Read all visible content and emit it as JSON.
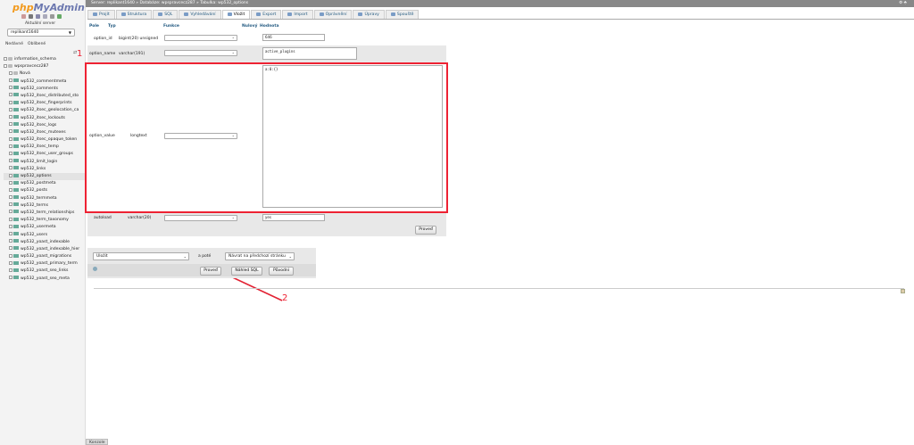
{
  "logo": {
    "part1": "php",
    "part2": "MyAdmin"
  },
  "left": {
    "server_label": "Aktuální server",
    "server_value": "replikant1640",
    "recent": "Nedávné",
    "favorites": "Oblíbené",
    "collapse": "⇄"
  },
  "tree": [
    {
      "label": "information_schema",
      "level": 1,
      "kind": "db"
    },
    {
      "label": "wpspravcecz287",
      "level": 1,
      "kind": "db"
    },
    {
      "label": "Nová",
      "level": 2,
      "kind": "new"
    },
    {
      "label": "wp532_commentmeta",
      "level": 2,
      "kind": "tbl"
    },
    {
      "label": "wp532_comments",
      "level": 2,
      "kind": "tbl"
    },
    {
      "label": "wp532_itsec_distributed_sto",
      "level": 2,
      "kind": "tbl"
    },
    {
      "label": "wp532_itsec_fingerprints",
      "level": 2,
      "kind": "tbl"
    },
    {
      "label": "wp532_itsec_geolocation_ca",
      "level": 2,
      "kind": "tbl"
    },
    {
      "label": "wp532_itsec_lockouts",
      "level": 2,
      "kind": "tbl"
    },
    {
      "label": "wp532_itsec_logs",
      "level": 2,
      "kind": "tbl"
    },
    {
      "label": "wp532_itsec_mutexes",
      "level": 2,
      "kind": "tbl"
    },
    {
      "label": "wp532_itsec_opaque_token",
      "level": 2,
      "kind": "tbl"
    },
    {
      "label": "wp532_itsec_temp",
      "level": 2,
      "kind": "tbl"
    },
    {
      "label": "wp532_itsec_user_groups",
      "level": 2,
      "kind": "tbl"
    },
    {
      "label": "wp532_limit_login",
      "level": 2,
      "kind": "tbl"
    },
    {
      "label": "wp532_links",
      "level": 2,
      "kind": "tbl"
    },
    {
      "label": "wp532_options",
      "level": 2,
      "kind": "tbl",
      "selected": true
    },
    {
      "label": "wp532_postmeta",
      "level": 2,
      "kind": "tbl"
    },
    {
      "label": "wp532_posts",
      "level": 2,
      "kind": "tbl"
    },
    {
      "label": "wp532_termmeta",
      "level": 2,
      "kind": "tbl"
    },
    {
      "label": "wp532_terms",
      "level": 2,
      "kind": "tbl"
    },
    {
      "label": "wp532_term_relationships",
      "level": 2,
      "kind": "tbl"
    },
    {
      "label": "wp532_term_taxonomy",
      "level": 2,
      "kind": "tbl"
    },
    {
      "label": "wp532_usermeta",
      "level": 2,
      "kind": "tbl"
    },
    {
      "label": "wp532_users",
      "level": 2,
      "kind": "tbl"
    },
    {
      "label": "wp532_yoast_indexable",
      "level": 2,
      "kind": "tbl"
    },
    {
      "label": "wp532_yoast_indexable_hier",
      "level": 2,
      "kind": "tbl"
    },
    {
      "label": "wp532_yoast_migrations",
      "level": 2,
      "kind": "tbl"
    },
    {
      "label": "wp532_yoast_primary_term",
      "level": 2,
      "kind": "tbl"
    },
    {
      "label": "wp532_yoast_seo_links",
      "level": 2,
      "kind": "tbl"
    },
    {
      "label": "wp532_yoast_seo_meta",
      "level": 2,
      "kind": "tbl"
    }
  ],
  "breadcrumb": {
    "text": "Server: replikant1640 » Databáze: wpspravcecz287 » Tabulka: wp532_options",
    "right": "⚙ ⬘"
  },
  "tabs": [
    {
      "label": "Projít",
      "active": false
    },
    {
      "label": "Struktura",
      "active": false
    },
    {
      "label": "SQL",
      "active": false
    },
    {
      "label": "Vyhledávání",
      "active": false
    },
    {
      "label": "Vložit",
      "active": true
    },
    {
      "label": "Export",
      "active": false
    },
    {
      "label": "Import",
      "active": false
    },
    {
      "label": "Oprávnění",
      "active": false
    },
    {
      "label": "Úpravy",
      "active": false
    },
    {
      "label": "Spouště",
      "active": false
    }
  ],
  "form": {
    "headers": {
      "field": "Pole",
      "type": "Typ",
      "function": "Funkce",
      "null": "Nulový",
      "value": "Hodnota"
    },
    "rows": [
      {
        "name": "option_id",
        "type": "bigint(20) unsigned",
        "value": "646"
      },
      {
        "name": "option_name",
        "type": "varchar(191)",
        "value": "active_plugins"
      },
      {
        "name": "option_value",
        "type": "longtext",
        "value": "a:0:{}"
      },
      {
        "name": "autoload",
        "type": "varchar(20)",
        "value": "yes"
      }
    ],
    "go": "Proveď"
  },
  "annotations": {
    "one": "1",
    "two": "2"
  },
  "bottom": {
    "action": "Uložit",
    "after_label": "a poté",
    "after_value": "Návrat na předchozí stránku",
    "go": "Proveď",
    "preview": "Náhled SQL",
    "reset": "Původní"
  },
  "console": "Konzole",
  "colors": {
    "annotation": "#e22233",
    "link": "#235a81",
    "logo_orange": "#f29a1e",
    "logo_blue": "#6c78af"
  }
}
